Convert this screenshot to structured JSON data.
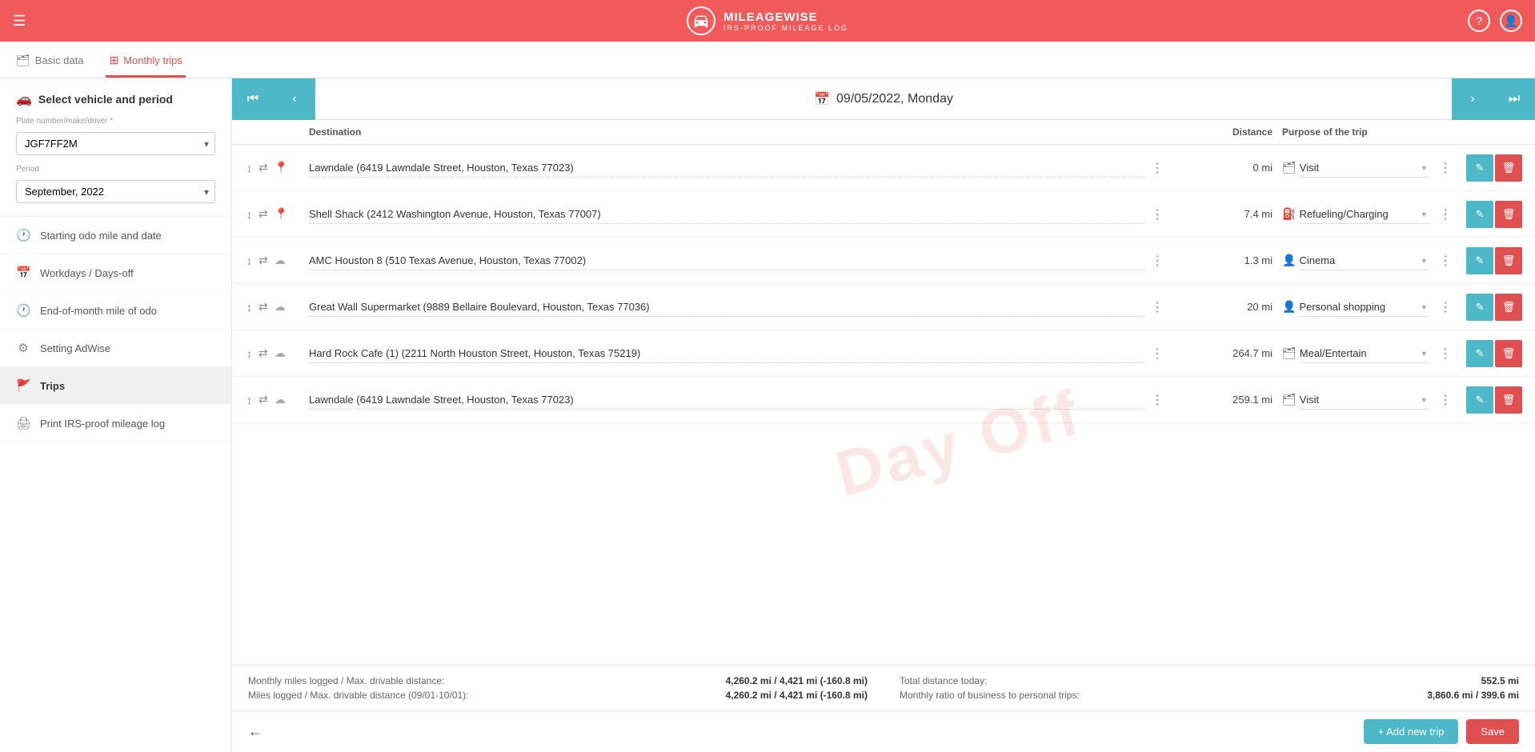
{
  "app": {
    "title": "MILEAGEWISE",
    "subtitle": "IRS-PROOF MILEAGE LOG"
  },
  "tabs": {
    "basic_data": "Basic data",
    "monthly_trips": "Monthly trips"
  },
  "sidebar": {
    "select_vehicle_label": "Select vehicle and period",
    "plate_field_label": "Plate number/make/driver *",
    "plate_value": "JGF7FF2M",
    "period_label": "Period",
    "period_value": "September, 2022",
    "menu_items": [
      {
        "id": "starting-odo",
        "label": "Starting odo mile and date",
        "icon": "🕐"
      },
      {
        "id": "workdays",
        "label": "Workdays / Days-off",
        "icon": "📅"
      },
      {
        "id": "end-of-month",
        "label": "End-of-month mile of odo",
        "icon": "🕐"
      },
      {
        "id": "setting-adwise",
        "label": "Setting AdWise",
        "icon": "⚙"
      },
      {
        "id": "trips",
        "label": "Trips",
        "icon": "🚩"
      },
      {
        "id": "print",
        "label": "Print IRS-proof mileage log",
        "icon": "🖨"
      }
    ]
  },
  "date_nav": {
    "date_text": "09/05/2022, Monday"
  },
  "table": {
    "headers": {
      "controls": "",
      "destination": "Destination",
      "distance": "Distance",
      "purpose": "Purpose of the trip",
      "actions": ""
    },
    "rows": [
      {
        "id": 1,
        "destination": "Lawndale (6419 Lawndale Street, Houston, Texas 77023)",
        "distance": "0 mi",
        "purpose": "Visit",
        "purpose_icon": "🗂"
      },
      {
        "id": 2,
        "destination": "Shell Shack (2412 Washington Avenue, Houston, Texas 77007)",
        "distance": "7.4 mi",
        "purpose": "Refueling/Charging",
        "purpose_icon": "⛽"
      },
      {
        "id": 3,
        "destination": "AMC Houston 8 (510 Texas Avenue, Houston, Texas 77002)",
        "distance": "1.3 mi",
        "purpose": "Cinema",
        "purpose_icon": "👤"
      },
      {
        "id": 4,
        "destination": "Great Wall Supermarket (9889 Bellaire Boulevard, Houston, Texas 77036)",
        "distance": "20 mi",
        "purpose": "Personal shopping",
        "purpose_icon": "👤"
      },
      {
        "id": 5,
        "destination": "Hard Rock Cafe (1) (2211 North Houston Street, Houston, Texas 75219)",
        "distance": "264.7 mi",
        "purpose": "Meal/Entertain",
        "purpose_icon": "🗂"
      },
      {
        "id": 6,
        "destination": "Lawndale (6419 Lawndale Street, Houston, Texas 77023)",
        "distance": "259.1 mi",
        "purpose": "Visit",
        "purpose_icon": "🗂"
      }
    ]
  },
  "watermark": "Day Off",
  "footer": {
    "stat1_label": "Monthly miles logged / Max. drivable distance:",
    "stat1_value": "4,260.2 mi / 4,421 mi (-160.8 mi)",
    "stat2_label": "Miles logged / Max. drivable distance (09/01-10/01):",
    "stat2_value": "4,260.2 mi / 4,421 mi (-160.8 mi)",
    "stat3_label": "Total distance today:",
    "stat3_value": "552.5 mi",
    "stat4_label": "Monthly ratio of business to personal trips:",
    "stat4_value": "3,860.6 mi / 399.6 mi",
    "add_trip_label": "+ Add new trip",
    "save_label": "Save"
  }
}
